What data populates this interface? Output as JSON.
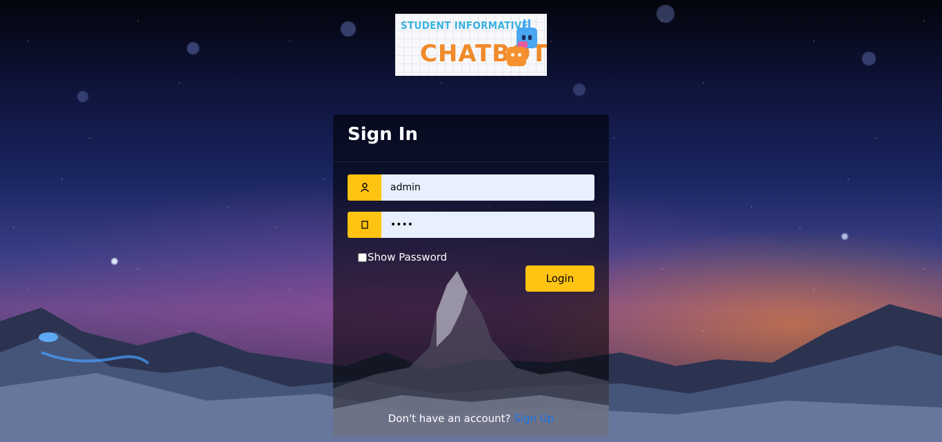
{
  "logo": {
    "line1": "STUDENT INFORMATIVE",
    "line2": "CHATBOT"
  },
  "card": {
    "title": "Sign In",
    "username": {
      "icon": "user-icon",
      "value": "admin"
    },
    "password": {
      "icon": "key-icon",
      "value": "••••"
    },
    "show_password_label": "Show Password",
    "show_password_checked": false,
    "login_label": "Login",
    "footer_text": "Don't have an account?",
    "signup_label": "Sign Up"
  },
  "colors": {
    "accent": "#ffc312",
    "link": "#1a73e8",
    "input_bg": "#e8f0fe"
  }
}
